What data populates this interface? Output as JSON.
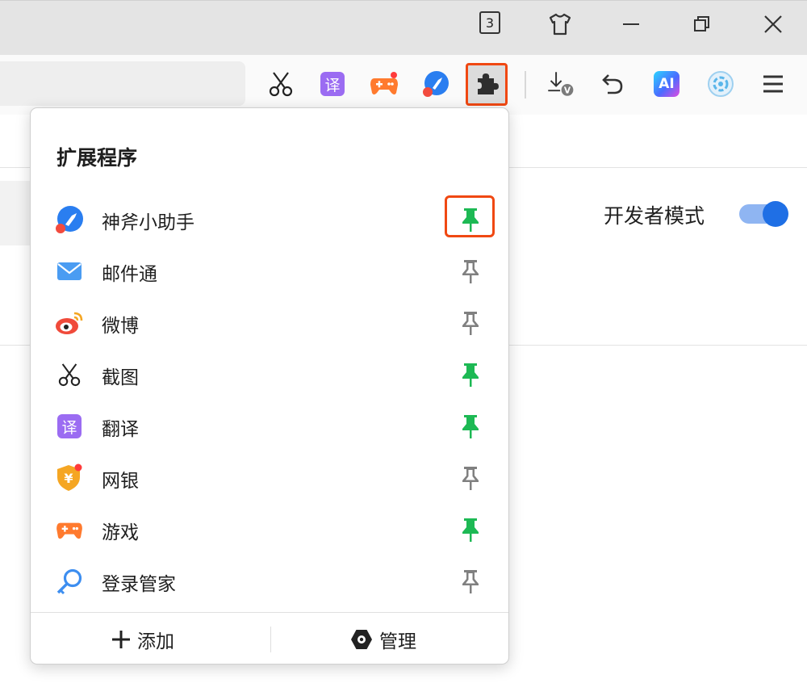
{
  "titlebar": {
    "tab_count": "3"
  },
  "toolbar": {
    "icons": [
      "scissors-icon",
      "translate-icon",
      "game-icon",
      "assistant-icon",
      "extensions-icon",
      "download-icon",
      "undo-icon",
      "ai-icon",
      "cloud-icon",
      "menu-icon"
    ],
    "translate_glyph": "译",
    "ai_label": "AI",
    "download_badge": "V"
  },
  "page": {
    "dev_mode_label": "开发者模式",
    "dev_mode_enabled": true
  },
  "popup": {
    "title": "扩展程序",
    "extensions": [
      {
        "name": "神斧小助手",
        "icon": "assistant-icon",
        "pinned": true
      },
      {
        "name": "邮件通",
        "icon": "mail-icon",
        "pinned": false
      },
      {
        "name": "微博",
        "icon": "weibo-icon",
        "pinned": false
      },
      {
        "name": "截图",
        "icon": "scissors-icon",
        "pinned": true
      },
      {
        "name": "翻译",
        "icon": "translate-icon",
        "pinned": true
      },
      {
        "name": "网银",
        "icon": "bank-shield-icon",
        "pinned": false
      },
      {
        "name": "游戏",
        "icon": "game-icon",
        "pinned": true
      },
      {
        "name": "登录管家",
        "icon": "key-icon",
        "pinned": false
      }
    ],
    "add_label": "添加",
    "manage_label": "管理",
    "bank_glyph": "¥"
  },
  "colors": {
    "pinned": "#1db954",
    "unpinned": "#808080",
    "highlight": "#f04812",
    "accent": "#1f6fe5"
  }
}
